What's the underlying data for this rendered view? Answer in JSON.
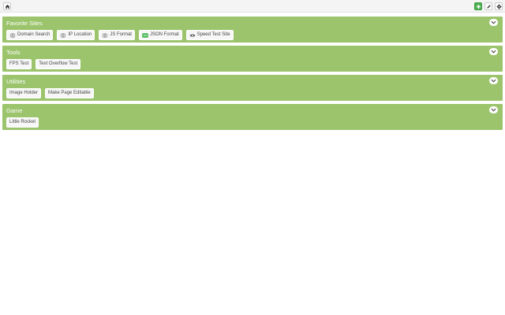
{
  "toolbar": {
    "home_icon": "home-icon",
    "add_icon": "plus-icon",
    "edit_icon": "pencil-icon",
    "settings_icon": "gear-icon",
    "add_color": "#4caf50"
  },
  "colors": {
    "section_bg": "#9bc46c",
    "chip_bg": "#f7f7f7",
    "chip_text": "#444444"
  },
  "sections": [
    {
      "title": "Favorite Sites",
      "links": [
        {
          "label": "Domain Search",
          "icon": "globe-icon"
        },
        {
          "label": "IP Location",
          "icon": "globe-icon"
        },
        {
          "label": "JS Format",
          "icon": "globe-icon"
        },
        {
          "label": "JSON Format",
          "icon": "json-icon"
        },
        {
          "label": "Speed Test Site",
          "icon": "eye-icon"
        }
      ]
    },
    {
      "title": "Tools",
      "links": [
        {
          "label": "FPS Test"
        },
        {
          "label": "Text Overflow Test"
        }
      ]
    },
    {
      "title": "Utilities",
      "links": [
        {
          "label": "Image Holder"
        },
        {
          "label": "Make Page Editable"
        }
      ]
    },
    {
      "title": "Game",
      "links": [
        {
          "label": "Little Rocket"
        }
      ]
    }
  ]
}
